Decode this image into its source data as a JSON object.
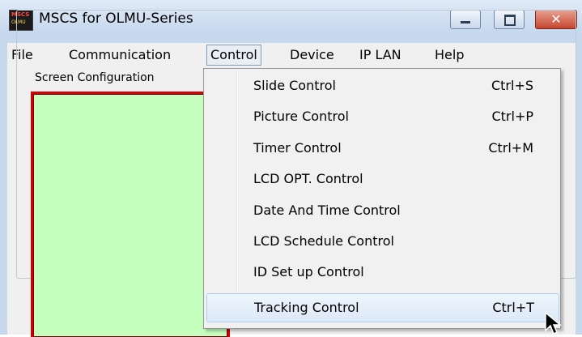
{
  "window": {
    "title": "MSCS for OLMU-Series",
    "icon_text_top": "MSCS",
    "icon_text_bottom": "OLMU"
  },
  "menubar": {
    "items": [
      {
        "label": "File"
      },
      {
        "label": "Communication"
      },
      {
        "label": "Control"
      },
      {
        "label": "Device"
      },
      {
        "label": "IP LAN"
      },
      {
        "label": "Help"
      }
    ],
    "active": "Control"
  },
  "main": {
    "group_label": "Screen Configuration",
    "screen_color": "#c4ffbe",
    "screen_border_color": "#d20000"
  },
  "control_menu": {
    "items": [
      {
        "label": "Slide Control",
        "shortcut": "Ctrl+S"
      },
      {
        "label": "Picture Control",
        "shortcut": "Ctrl+P"
      },
      {
        "label": "Timer Control",
        "shortcut": "Ctrl+M"
      },
      {
        "label": "LCD OPT. Control",
        "shortcut": ""
      },
      {
        "label": "Date And Time Control",
        "shortcut": ""
      },
      {
        "label": "LCD Schedule Control",
        "shortcut": ""
      },
      {
        "label": "ID Set up Control",
        "shortcut": ""
      },
      {
        "label": "Tracking Control",
        "shortcut": "Ctrl+T"
      }
    ],
    "highlighted": "Tracking Control"
  }
}
